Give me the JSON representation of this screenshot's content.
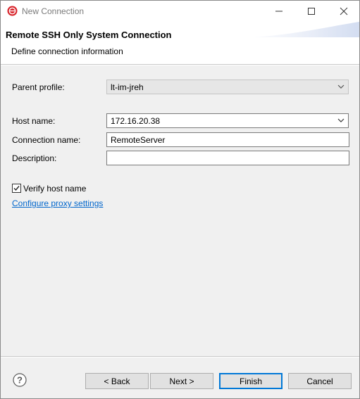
{
  "window": {
    "title": "New Connection"
  },
  "header": {
    "title": "Remote SSH Only System Connection",
    "subtitle": "Define connection information"
  },
  "form": {
    "parent_profile": {
      "label": "Parent profile:",
      "value": "lt-im-jreh"
    },
    "host_name": {
      "label": "Host name:",
      "value": "172.16.20.38"
    },
    "connection_name": {
      "label": "Connection name:",
      "value": "RemoteServer"
    },
    "description": {
      "label": "Description:",
      "value": ""
    },
    "verify_host": {
      "label": "Verify host name",
      "checked": true
    },
    "proxy_link": "Configure proxy settings"
  },
  "buttons": {
    "back": "< Back",
    "next": "Next >",
    "finish": "Finish",
    "cancel": "Cancel"
  },
  "icons": {
    "app": "eclipse-logo-icon",
    "minimize": "minimize-icon",
    "maximize": "maximize-icon",
    "close": "close-icon",
    "help": "help-icon"
  },
  "colors": {
    "link": "#0066cc",
    "default_button_border": "#0078d7",
    "app_icon": "#d8232a"
  }
}
